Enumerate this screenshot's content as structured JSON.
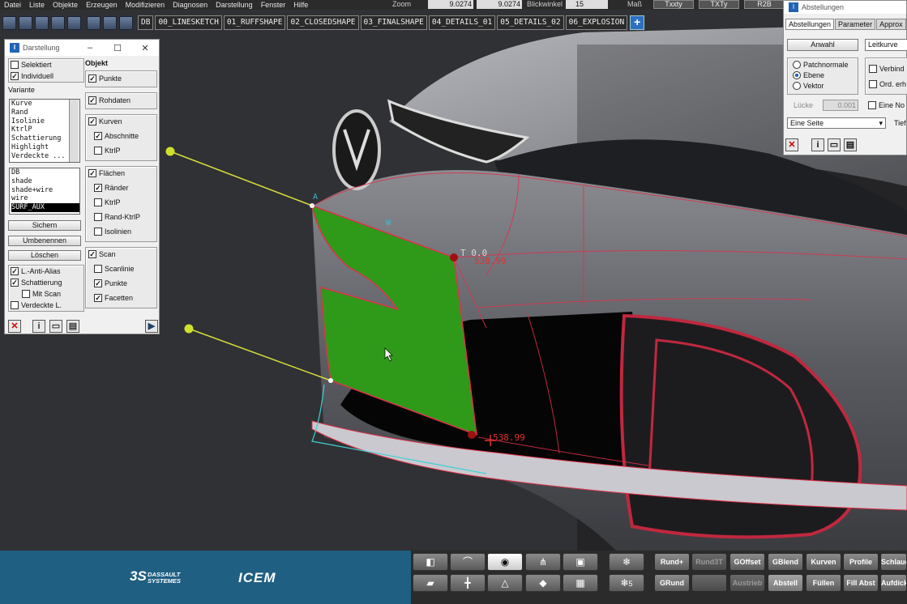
{
  "menu": [
    "Datei",
    "Liste",
    "Objekte",
    "Erzeugen",
    "Modifizieren",
    "Diagnosen",
    "Darstellung",
    "Fenster",
    "Hilfe"
  ],
  "topfields": {
    "zoom_label": "Zoom",
    "zoom_value_1": "9.0274",
    "zoom_value_2": "9.0274",
    "blickwinkel_label": "Blickwinkel",
    "blickwinkel_value": "15",
    "mass_label": "Maß",
    "buttons": [
      "Txxty",
      "TXTy",
      "R2B"
    ]
  },
  "layer_tabs": [
    "DB",
    "00_LINESKETCH",
    "01_RUFFSHAPE",
    "02_CLOSEDSHAPE",
    "03_FINALSHAPE",
    "04_DETAILS_01",
    "05_DETAILS_02",
    "06_EXPLOSION"
  ],
  "plus_label": "+",
  "darstellung": {
    "title": "Darstellung",
    "selektiert": "Selektiert",
    "individuell": "Individuell",
    "variante_label": "Variante",
    "variante_items": [
      "Kurve",
      "Rand",
      "Isolinie",
      "KtrlP",
      "Schattierung",
      "Highlight",
      "Verdeckte ..."
    ],
    "shade_items": [
      "DB",
      "shade",
      "shade+wire",
      "wire",
      "SURF_AUX"
    ],
    "sichern": "Sichern",
    "umbenennen": "Umbenennen",
    "loeschen": "Löschen",
    "anti_alias": "L.-Anti-Alias",
    "schattierung": "Schattierung",
    "mit_scan": "Mit Scan",
    "verdeckte_l": "Verdeckte L.",
    "objekt_label": "Objekt",
    "punkte": "Punkte",
    "rohdaten": "Rohdaten",
    "kurven": "Kurven",
    "abschnitte": "Abschnitte",
    "ktrlp": "KtrlP",
    "flaechen": "Flächen",
    "raender": "Ränder",
    "ktrlp2": "KtrlP",
    "rand_ktrlp": "Rand-KtrlP",
    "isolinien": "Isolinien",
    "scan": "Scan",
    "scanlinie": "Scanlinie",
    "scan_punkte": "Punkte",
    "facetten": "Facetten"
  },
  "abstellungen": {
    "title": "Abstellungen",
    "tabs": [
      "Abstellungen",
      "Parameter",
      "Approx"
    ],
    "anwahl": "Anwahl",
    "leitkurve": "Leitkurve",
    "patchnormale": "Patchnormale",
    "ebene": "Ebene",
    "vektor": "Vektor",
    "verbind": "Verbind",
    "ord_erh": "Ord. erh",
    "luecke_label": "Lücke",
    "luecke_value": "0.001",
    "eine_no": "Eine No",
    "dropdown": "Eine Seite",
    "tief": "Tief"
  },
  "viewport_labels": {
    "t_label": "T 0.0",
    "dim_top": "538.99",
    "dim_bottom": "538.99",
    "w_label": "W",
    "a_label": "A"
  },
  "brand": {
    "dassault": "DASSAULT\nSYSTEMES",
    "ds_mark": "3S",
    "icem": "ICEM"
  },
  "bottom_buttons_row1": [
    "Rund+",
    "Rund3T",
    "GOffset",
    "GBlend",
    "Kurven",
    "Profile",
    "Schlauch"
  ],
  "bottom_buttons_row2": [
    "GRund",
    "",
    "Austrieb",
    "Abstell",
    "Füllen",
    "Fill Abst",
    "Aufdicke"
  ],
  "bottom_icon_row2_label": "5",
  "colors": {
    "surface_green": "#2f9a1a",
    "edge_red": "#e0304a",
    "guide_yellow": "#e8ef3a",
    "brand_blue": "#1f5f82"
  }
}
